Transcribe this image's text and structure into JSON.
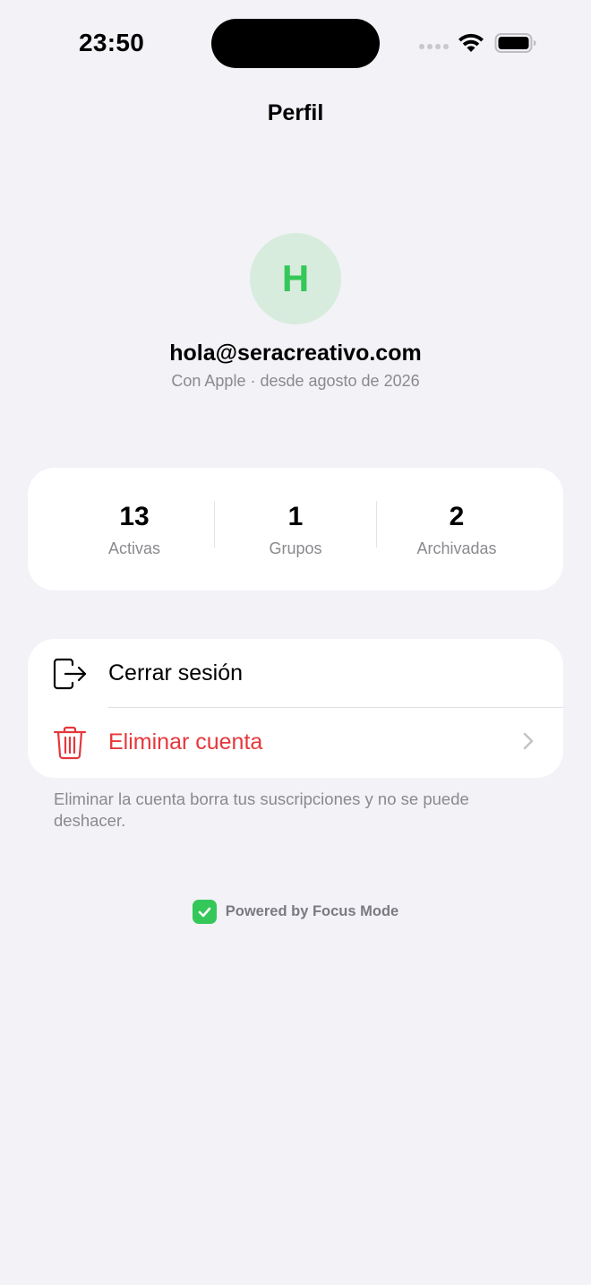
{
  "status_bar": {
    "time": "23:50"
  },
  "nav": {
    "title": "Perfil"
  },
  "profile": {
    "avatar_initial": "H",
    "email": "hola@seracreativo.com",
    "subtitle": "Con Apple · desde agosto de 2026"
  },
  "stats": [
    {
      "value": "13",
      "label": "Activas"
    },
    {
      "value": "1",
      "label": "Grupos"
    },
    {
      "value": "2",
      "label": "Archivadas"
    }
  ],
  "actions": {
    "logout_label": "Cerrar sesión",
    "delete_label": "Eliminar cuenta"
  },
  "footnote": "Eliminar la cuenta borra tus suscripciones y no se puede deshacer.",
  "footer": {
    "powered_by": "Powered by Focus Mode"
  },
  "colors": {
    "accent_green": "#34c759",
    "destructive_red": "#e5383b",
    "background": "#f2f2f7"
  },
  "icons": {
    "logout": "logout-icon",
    "delete": "trash-icon",
    "chevron": "chevron-right-icon",
    "check": "checkmark-icon"
  }
}
